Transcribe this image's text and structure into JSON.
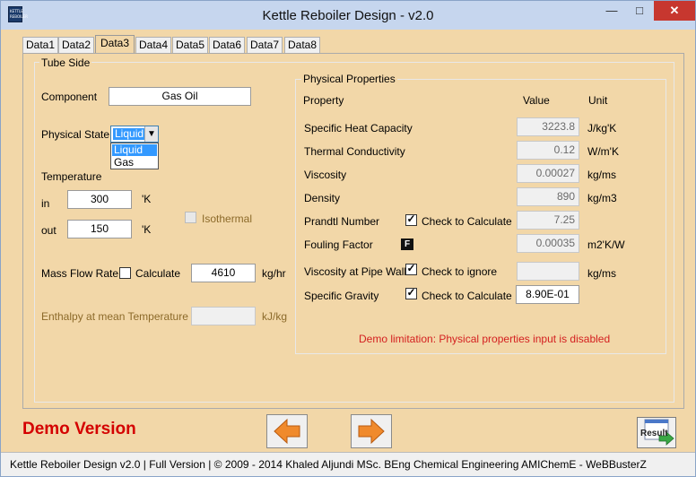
{
  "window": {
    "title": "Kettle Reboiler Design - v2.0",
    "min": "—",
    "max": "□",
    "close": "✕",
    "icon_text": [
      "KETTLE",
      "REBOILER"
    ]
  },
  "tabs": [
    "Data1",
    "Data2",
    "Data3",
    "Data4",
    "Data5",
    "Data6",
    "Data7",
    "Data8"
  ],
  "active_tab": "Data3",
  "tube_side": {
    "title": "Tube Side",
    "component_label": "Component",
    "component_value": "Gas Oil",
    "physical_state_label": "Physical State",
    "physical_state_value": "Liquid",
    "physical_state_options": [
      "Liquid",
      "Gas"
    ],
    "temperature_label": "Temperature",
    "in_label": "in",
    "in_value": "300",
    "in_unit": "'K",
    "out_label": "out",
    "out_value": "150",
    "out_unit": "'K",
    "isothermal_label": "Isothermal",
    "mass_flow_label": "Mass Flow Rate",
    "calculate_label": "Calculate",
    "mass_flow_value": "4610",
    "mass_flow_unit": "kg/hr",
    "enthalpy_label": "Enthalpy at mean Temperature",
    "enthalpy_value": "",
    "enthalpy_unit": "kJ/kg"
  },
  "physical_properties": {
    "title": "Physical Properties",
    "header_property": "Property",
    "header_value": "Value",
    "header_unit": "Unit",
    "rows": [
      {
        "label": "Specific Heat Capacity",
        "value": "3223.8",
        "unit": "J/kg'K"
      },
      {
        "label": "Thermal Conductivity",
        "value": "0.12",
        "unit": "W/m'K"
      },
      {
        "label": "Viscosity",
        "value": "0.00027",
        "unit": "kg/ms"
      },
      {
        "label": "Density",
        "value": "890",
        "unit": "kg/m3"
      },
      {
        "label": "Prandtl Number",
        "check": "Check to Calculate",
        "value": "7.25",
        "unit": ""
      },
      {
        "label": "Fouling Factor",
        "value": "0.00035",
        "unit": "m2'K/W",
        "badge": "F"
      },
      {
        "label": "Viscosity at Pipe Wall",
        "check": "Check to ignore",
        "value": "",
        "unit": "kg/ms"
      },
      {
        "label": "Specific Gravity",
        "check": "Check to Calculate",
        "value": "8.90E-01",
        "unit": ""
      }
    ],
    "demo_note": "Demo limitation: Physical properties input is disabled"
  },
  "footer": {
    "demo_version": "Demo Version",
    "result_label": "Result",
    "status": "Kettle Reboiler Design  v2.0  |  Full Version  |  © 2009 - 2014 Khaled Aljundi MSc. BEng Chemical Engineering AMIChemE - WeBBusterZ"
  },
  "colors": {
    "form_bg": "#f2d7a8",
    "arrow_orange": "#f08a2c",
    "demo_red": "#d40000"
  }
}
